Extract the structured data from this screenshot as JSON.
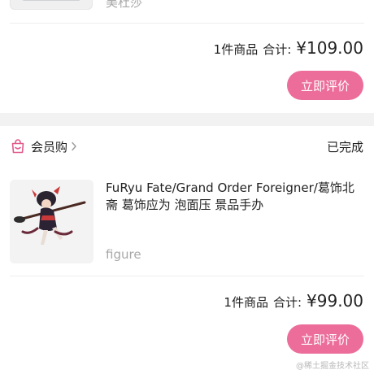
{
  "previous_order": {
    "spec_text": "美杜莎",
    "item_count": "1件商品",
    "total_label": "合计:",
    "total_price": "¥109.00",
    "review_button": "立即评价"
  },
  "order": {
    "shop_name": "会员购",
    "status": "已完成",
    "product_title": "FuRyu Fate/Grand Order Foreigner/葛饰北斋 葛饰应为 泡面压 景品手办",
    "product_spec": "figure",
    "item_count": "1件商品",
    "total_label": "合计:",
    "total_price": "¥99.00",
    "review_button": "立即评价"
  },
  "watermark": "@稀土掘金技术社区",
  "colors": {
    "accent": "#ec6d9a",
    "page_background": "#f2f2f2",
    "card_background": "#ffffff",
    "muted_text": "#a8a8a8"
  },
  "icons": {
    "shop_icon": "shopping-bag-icon",
    "shop_chevron": "chevron-right-icon"
  }
}
